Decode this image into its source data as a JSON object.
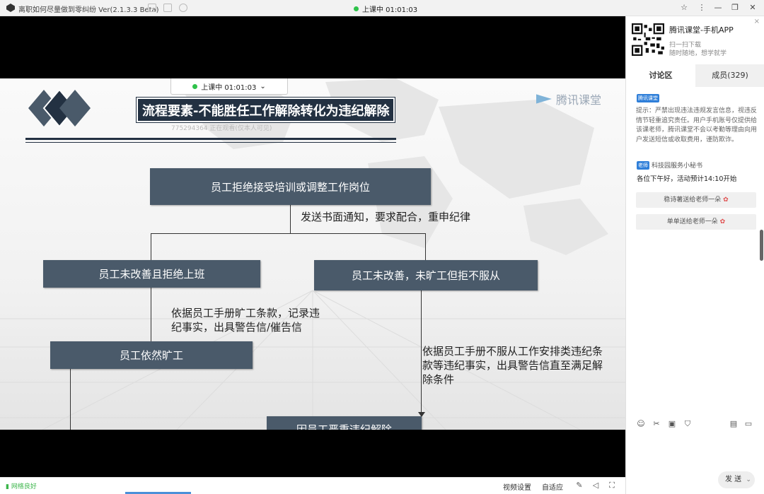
{
  "window": {
    "title": "离职如何尽量做到零纠纷 Ver(2.1.3.3 Beta)",
    "live_status": "上课中 01:01:03"
  },
  "slide": {
    "live_pill": "上课中 01:01:03",
    "title": "流程要素-不能胜任工作解除转化为违纪解除",
    "watermark": "775294364 正在观看(仅本人可见)",
    "brand": "腾讯课堂",
    "nodes": {
      "top": "员工拒绝接受培训或调整工作岗位",
      "left": "员工未改善且拒绝上班",
      "right": "员工未改善，未旷工但拒不服从",
      "left2": "员工依然旷工",
      "bottom": "因员工严重违纪解除"
    },
    "edges": {
      "notify": "发送书面通知，要求配合，重申纪律",
      "absent_line1": "依据员工手册旷工条款，记录违",
      "absent_line2": "纪事实，出具警告信/催告信",
      "refuse_line1": "依据员工手册不服从工作安排类违纪条",
      "refuse_line2": "款等违纪事实，出具警告信直至满足解",
      "refuse_line3": "除条件"
    }
  },
  "video_bar": {
    "network": "网络良好",
    "settings": "视频设置",
    "adaptive": "自适应"
  },
  "sidebar": {
    "app_name": "腾讯课堂-手机APP",
    "app_sub1": "扫一扫下载",
    "app_sub2": "随时随地，想学就学",
    "tabs": [
      {
        "label": "讨论区"
      },
      {
        "label": "成员(329)"
      }
    ],
    "badge": "腾讯课堂",
    "notice": "提示：严禁出现违法违规发言信息，视违反情节轻重追究责任。用户手机账号仅提供给该课老师，腾讯课堂不会以考勤等理由向用户发送短信或收取费用，谨防欺诈。",
    "teacher_tag": "老师",
    "sender": "科技园服务小秘书",
    "message": "各位下午好，活动预计14:10开始",
    "gifts": [
      "稳诗薯送给老师一朵",
      "单单送给老师一朵"
    ],
    "send_label": "发 送"
  },
  "colors": {
    "slide_navy": "#233142",
    "node_fill": "#4a5a6a",
    "accent_blue": "#2f7fd9",
    "live_green": "#2ec24a"
  }
}
